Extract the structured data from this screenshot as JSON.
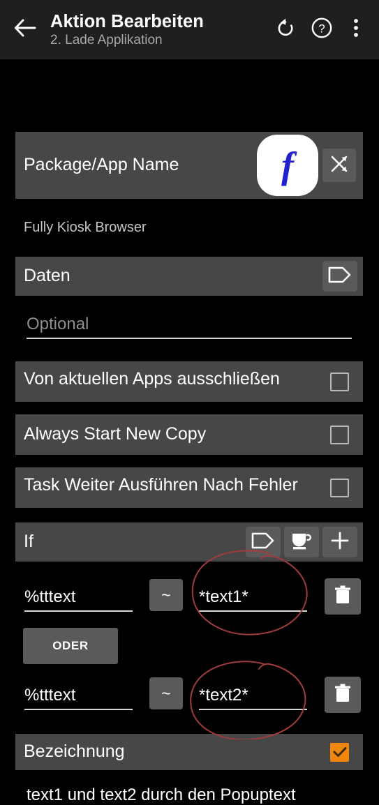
{
  "appbar": {
    "back_icon": "arrow-left-icon",
    "title": "Aktion Bearbeiten",
    "subtitle": "2. Lade Applikation",
    "actions": [
      {
        "name": "undo-icon",
        "label": "undo"
      },
      {
        "name": "help-icon",
        "label": "help"
      },
      {
        "name": "overflow-menu-icon",
        "label": "more options"
      }
    ]
  },
  "fields": {
    "package_app_name": {
      "label": "Package/App Name",
      "app_logo_letter": "f",
      "app_logo_bg": "#ffffff",
      "app_logo_color": "#2222cc",
      "action_icon": "shuffle-icon"
    },
    "package_app_value": "Fully Kiosk Browser",
    "daten": {
      "label": "Daten",
      "action_icon": "tag-icon"
    },
    "daten_input": {
      "value": "",
      "placeholder": "Optional"
    },
    "checkboxes": [
      {
        "label": "Von aktuellen Apps ausschließen",
        "checked": false,
        "name": "exclude-from-recent-apps"
      },
      {
        "label": "Always Start New Copy",
        "checked": false,
        "name": "always-start-new-copy"
      },
      {
        "label": "Task Weiter Ausführen Nach Fehler",
        "checked": false,
        "name": "continue-task-after-error"
      }
    ],
    "if_section": {
      "label": "If",
      "icons": [
        "tag-icon",
        "coffee-cup-icon",
        "plus-icon"
      ]
    },
    "conditions": [
      {
        "variable": "%tttext",
        "operator": "~",
        "value": "*text1*",
        "delete_icon": "trash-icon"
      },
      {
        "variable": "%tttext",
        "operator": "~",
        "value": "*text2*",
        "delete_icon": "trash-icon"
      }
    ],
    "join_operator": "ODER",
    "bezeichnung": {
      "label": "Bezeichnung",
      "checked": true,
      "checkbox_color": "#f0860d"
    },
    "bottom_note": "text1 und text2 durch den Popuptext"
  },
  "annotations": {
    "circle_color": "#a03c3c",
    "circles": [
      "circle-around-text1-field",
      "circle-around-text2-field"
    ]
  }
}
